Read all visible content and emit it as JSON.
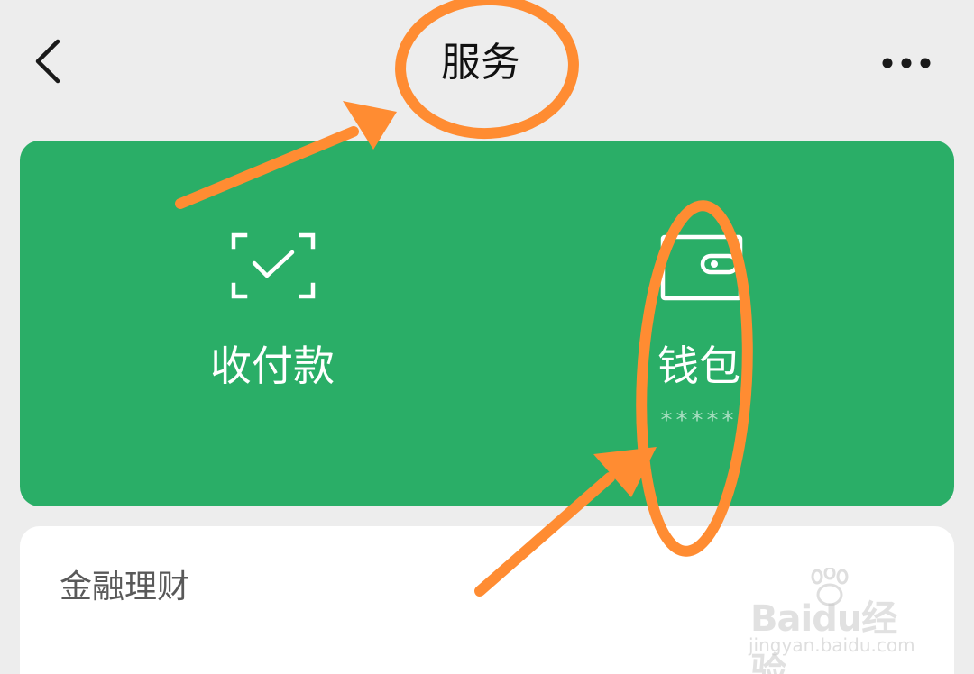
{
  "nav": {
    "title": "服务",
    "back_icon": "chevron-left-icon",
    "more_icon": "more-horizontal-icon"
  },
  "services": [
    {
      "label": "收付款",
      "icon": "scan-check-icon"
    },
    {
      "label": "钱包",
      "sub": "*****",
      "icon": "wallet-icon"
    }
  ],
  "finance": {
    "title": "金融理财"
  },
  "watermark": {
    "brand": "Baidu经验",
    "url": "jingyan.baidu.com"
  },
  "colors": {
    "background": "#ededed",
    "card_green": "#2aae67",
    "annotation_orange": "#ff8c32"
  }
}
